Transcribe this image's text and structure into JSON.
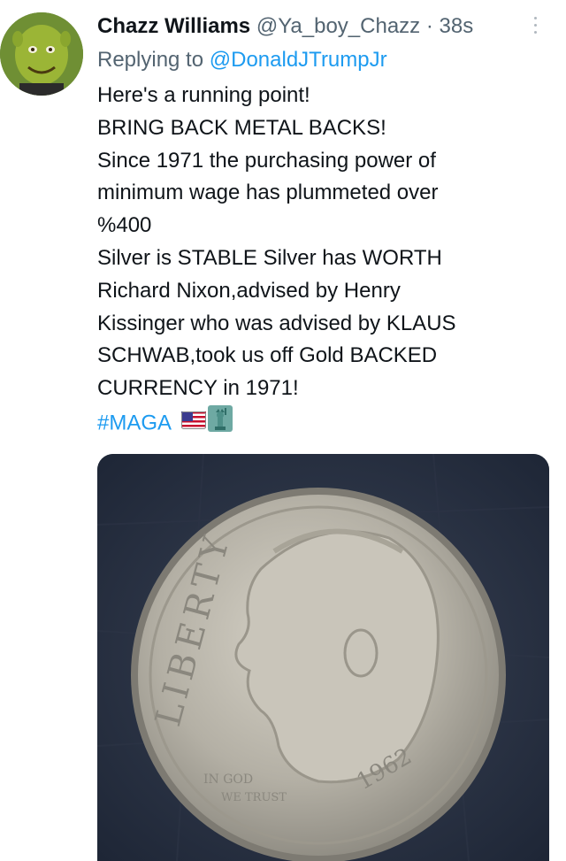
{
  "author": {
    "display_name": "Chazz Williams",
    "handle": "@Ya_boy_Chazz",
    "separator": "·",
    "time": "38s",
    "avatar_icon": "shrek-avatar"
  },
  "reply": {
    "prefix": "Replying to",
    "handle": "@DonaldJTrumpJr"
  },
  "tweet": {
    "lines": [
      "Here's a running point!",
      "BRING BACK METAL BACKS!",
      "Since 1971 the purchasing power of",
      "minimum wage has plummeted over",
      "%400",
      "Silver is STABLE Silver has WORTH",
      "Richard Nixon,advised by Henry",
      "Kissinger who was advised by KLAUS",
      "SCHWAB,took us off Gold BACKED",
      "CURRENCY in 1971!"
    ],
    "hashtag": "#MAGA",
    "emoji_icons": [
      "us-flag-icon",
      "statue-of-liberty-icon"
    ]
  },
  "media": {
    "coin_text": {
      "liberty": "LIBERTY",
      "motto_top": "IN GOD",
      "motto_bottom": "WE TRUST",
      "year": "1962"
    }
  },
  "colors": {
    "text": "#0f1419",
    "secondary": "#536471",
    "link": "#1d9bf0"
  }
}
